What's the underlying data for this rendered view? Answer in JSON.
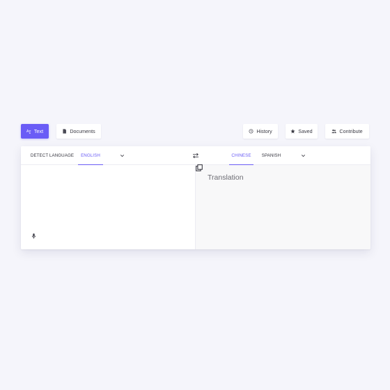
{
  "toolbar": {
    "text_label": "Text",
    "documents_label": "Documents",
    "history_label": "History",
    "saved_label": "Saved",
    "contribute_label": "Contribute"
  },
  "source": {
    "detect_label": "DETECT LANGUAGE",
    "english_label": "ENGLISH"
  },
  "target": {
    "chinese_label": "CHINESE",
    "spanish_label": "SPANISH",
    "placeholder": "Translation"
  },
  "colors": {
    "accent": "#6a5cf6",
    "background": "#f5f5fb",
    "panel": "#ffffff",
    "target_pane": "#f8f8f9"
  }
}
